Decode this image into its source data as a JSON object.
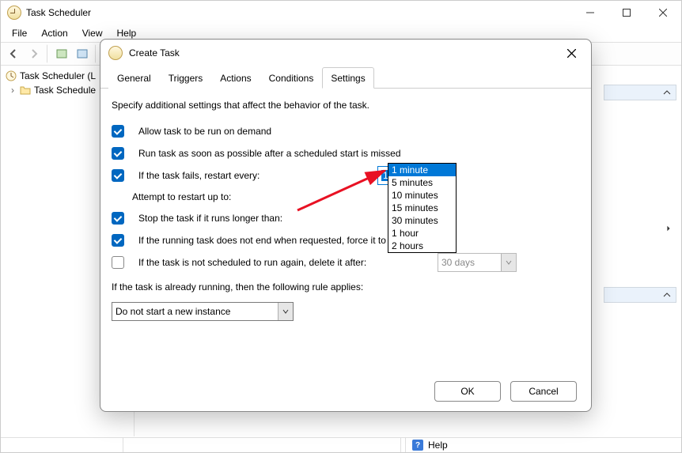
{
  "window": {
    "title": "Task Scheduler",
    "menu": [
      "File",
      "Action",
      "View",
      "Help"
    ]
  },
  "tree": {
    "root": "Task Scheduler (L",
    "child": "Task Schedule"
  },
  "help_label": "Help",
  "dialog": {
    "title": "Create Task",
    "tabs": [
      "General",
      "Triggers",
      "Actions",
      "Conditions",
      "Settings"
    ],
    "active_tab": "Settings",
    "desc": "Specify additional settings that affect the behavior of the task.",
    "opt_allow": "Allow task to be run on demand",
    "opt_runasap": "Run task as soon as possible after a scheduled start is missed",
    "opt_fails": "If the task fails, restart every:",
    "restart_every_value": "1 minute",
    "attempt_label": "Attempt to restart up to:",
    "opt_stop": "Stop the task if it runs longer than:",
    "opt_force": "If the running task does not end when requested, force it to st",
    "opt_delete": "If the task is not scheduled to run again, delete it after:",
    "delete_value": "30 days",
    "rule_label": "If the task is already running, then the following rule applies:",
    "rule_value": "Do not start a new instance",
    "ok": "OK",
    "cancel": "Cancel"
  },
  "dropdown_options": [
    "1 minute",
    "5 minutes",
    "10 minutes",
    "15 minutes",
    "30 minutes",
    "1 hour",
    "2 hours"
  ]
}
